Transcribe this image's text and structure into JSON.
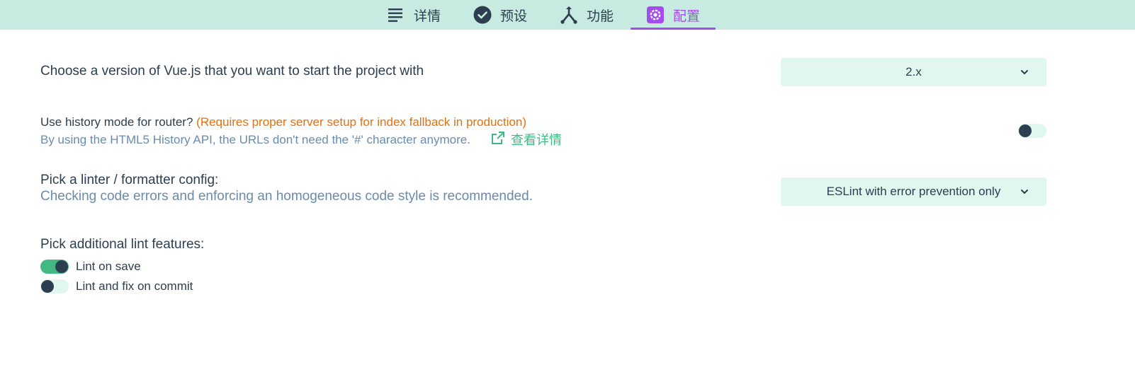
{
  "tabs": [
    {
      "label": "详情",
      "icon": "list-icon"
    },
    {
      "label": "预设",
      "icon": "check-circle-icon"
    },
    {
      "label": "功能",
      "icon": "merge-icon"
    },
    {
      "label": "配置",
      "icon": "gear-icon"
    }
  ],
  "active_tab": "配置",
  "prompts": {
    "vue_version": {
      "label": "Choose a version of Vue.js that you want to start the project with",
      "value": "2.x"
    },
    "history_mode": {
      "label": "Use history mode for router?",
      "warning": "(Requires proper server setup for index fallback in production)",
      "description": "By using the HTML5 History API, the URLs don't need the '#' character anymore.",
      "link_label": "查看详情",
      "enabled": false
    },
    "linter": {
      "label": "Pick a linter / formatter config:",
      "description": "Checking code errors and enforcing an homogeneous code style is recommended.",
      "value": "ESLint with error prevention only"
    },
    "lint_features": {
      "label": "Pick additional lint features:",
      "options": [
        {
          "label": "Lint on save",
          "enabled": true
        },
        {
          "label": "Lint and fix on commit",
          "enabled": false
        }
      ]
    }
  },
  "colors": {
    "topbar": "#c7ebe0",
    "accent": "#a44cf0",
    "green": "#42b983",
    "warning": "#e8700a",
    "muted": "#6a8bad",
    "text": "#2c3e50"
  }
}
